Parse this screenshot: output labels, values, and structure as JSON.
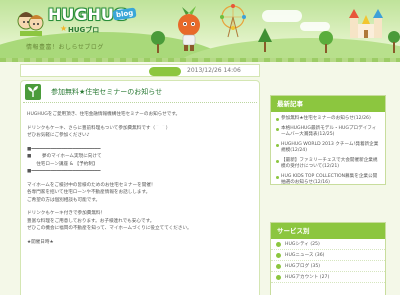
{
  "header": {
    "logo_title": "HUGHUG",
    "logo_badge": "blog",
    "logo_subtitle": "HUGブロ",
    "logo_kids_text": "HUG",
    "tagline": "情報豊富！おしらせブログ"
  },
  "post": {
    "date": "2013/12/26 14:06",
    "title": "参加無料★住宅セミナーのお知らせ",
    "body_lines": [
      "HUGHUGをご愛用頂き、住宅金融情報機構住宅セミナーのお知らせです。",
      "",
      "ドリンクもケーキ、さらに豊前料理もついて参加費無料です（＾ ＾）",
      "ぜひお気軽にご参加ください♪",
      "",
      "■━━━━━━━━━━━━━━━━━━━━━━━━━",
      "■ 　　夢のマイホーム実現に向けて",
      "　　住宅ローン講座 & 【予約制】",
      "■━━━━━━━━━━━━━━━━━━━━━━━━━",
      "",
      "マイホームをご検討中の皆様のためのお住宅セミナーを開催！",
      "各専門家を招いて住宅ローンや不動産情報をお話しします。",
      "ご希望の方は個別相談も可能です。",
      "",
      "ドリンクもケーキ付きで参加費無料！",
      "豊富な料理をご用意しております。お子様連れでも安心です。",
      "ぜひこの機会に福岡の不動産を知って、マイホームづくりに役立ててください。",
      "",
      "★開催日時★"
    ]
  },
  "sidebar": {
    "recent_heading": "最新記事",
    "recent_items": [
      "参加無料★住宅セミナーのお知らせ(12/26)",
      "本格HUGHUG最新モデル・HUGプロデイフィームバー大賞発表(12/25)",
      "HUGHUG WORLD 2013 クチーム!発着新企業規模(12/24)",
      "【最新】ファミリーチェスで大会開催新企業規模の受付けについて(12/21)",
      "HUG KIDS TOP COLLECTION募集を企業公開抽選のお知らせ(12/16)"
    ],
    "services_heading": "サービス別",
    "services": [
      "HUGシティ (25)",
      "HUGニュース (36)",
      "HUGブログ (35)",
      "HUGアカウント (27)"
    ]
  },
  "colors": {
    "accent_green": "#8cc63f",
    "dark_green": "#2a7a34",
    "background": "#f4f8e8",
    "link_green": "#2a7a34"
  }
}
